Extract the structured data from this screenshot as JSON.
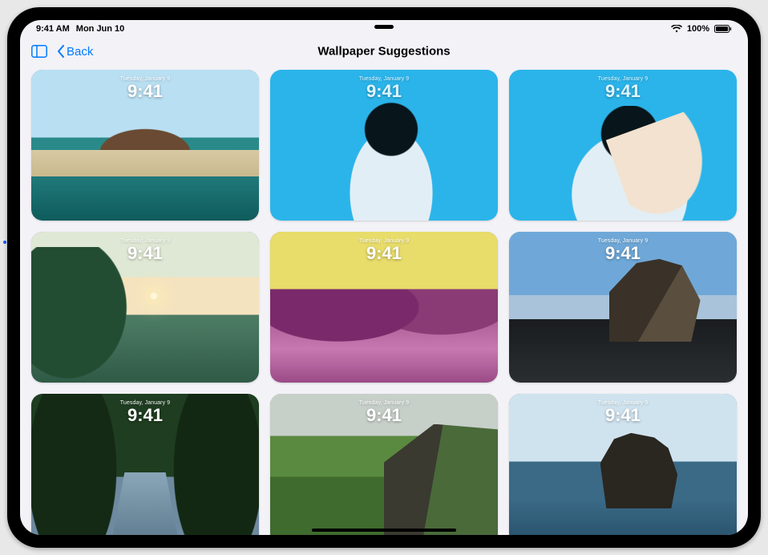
{
  "status": {
    "time": "9:41 AM",
    "date": "Mon Jun 10",
    "battery_pct": "100%"
  },
  "nav": {
    "back_label": "Back",
    "title": "Wallpaper Suggestions"
  },
  "preview": {
    "date": "Tuesday, January 9",
    "time": "9:41"
  },
  "tiles": [
    {
      "name": "wallpaper-volcano-lagoon"
    },
    {
      "name": "wallpaper-portrait-blue-1"
    },
    {
      "name": "wallpaper-portrait-blue-2"
    },
    {
      "name": "wallpaper-jungle-sunset"
    },
    {
      "name": "wallpaper-beach-duotone"
    },
    {
      "name": "wallpaper-black-sand-rock"
    },
    {
      "name": "wallpaper-forest-stream"
    },
    {
      "name": "wallpaper-green-highlands"
    },
    {
      "name": "wallpaper-sea-stack"
    }
  ]
}
